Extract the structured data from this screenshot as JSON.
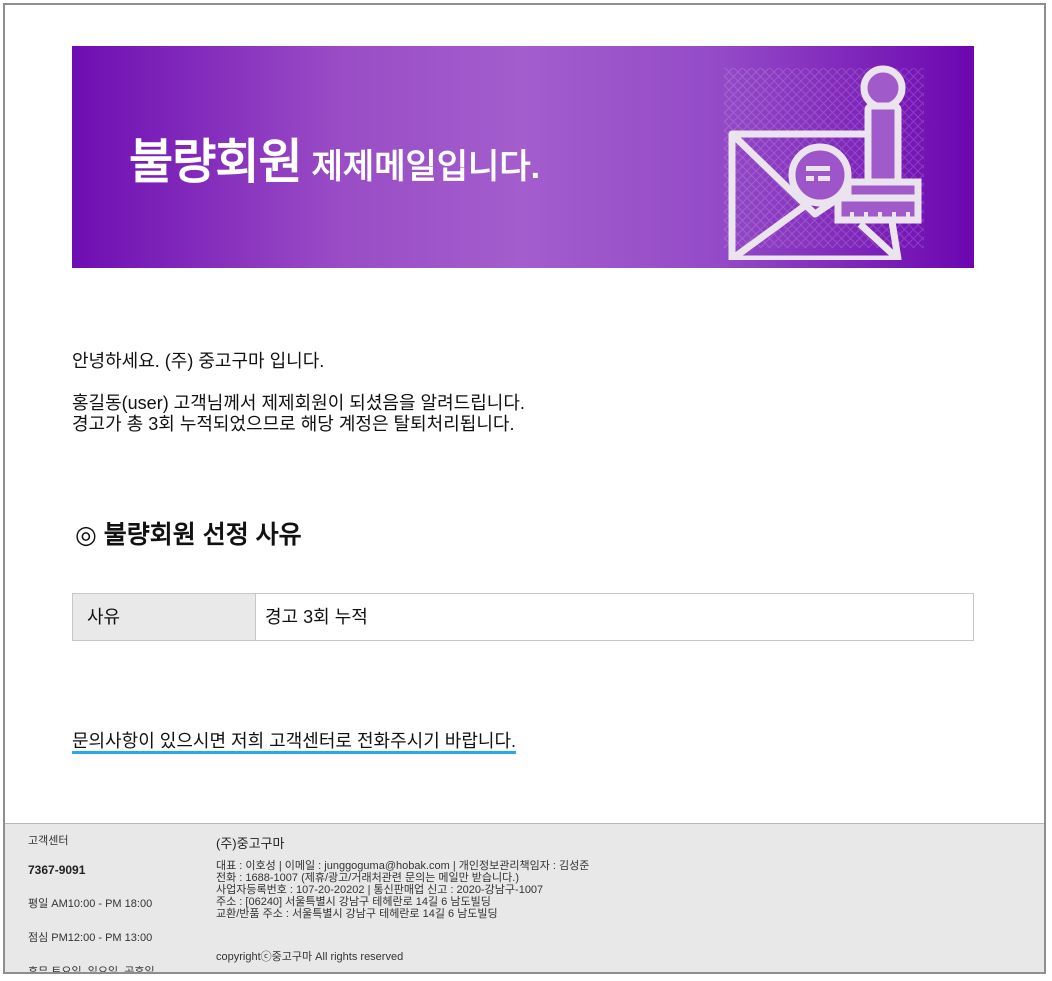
{
  "banner": {
    "title_strong": "불량회원",
    "title_rest": "제제메일입니다."
  },
  "body": {
    "greeting": "안녕하세요. (주) 중고구마 입니다.",
    "message_line1": "홍길동(user) 고객님께서 제제회원이 되셨음을 알려드립니다.",
    "message_line2": "경고가 총 3회 누적되었으므로 해당 계정은 탈퇴처리됩니다.",
    "section_title": "◎ 불량회원 선정 사유",
    "reason_label": "사유",
    "reason_value": "경고 3회 누적",
    "contact_text": "문의사항이 있으시면 저희 고객센터로 전화주시기 바랍니다."
  },
  "footer": {
    "cs_label": "고객센터",
    "cs_phone": "7367-9091",
    "weekday_hours": "평일 AM10:00 - PM 18:00",
    "lunch_hours": "점심 PM12:00 - PM 13:00",
    "holidays": "휴무 토요일, 일요일, 공휴일",
    "company_name": "(주)중고구마",
    "info_line1": "대표 : 이호성  |  이메일 :  junggoguma@hobak.com  |  개인정보관리책임자 : 김성준",
    "info_line2": "전화 : 1688-1007 (제휴/광고/거래처관련 문의는 메일만 받습니다.)",
    "info_line3": "사업자등록번호 : 107-20-20202  |  통신판매업 신고 : 2020-강남구-1007",
    "info_line4": "주소 : [06240] 서울특별시 강남구 테헤란로 14길 6 남도빌딩",
    "info_line5": "교환/반품 주소 : 서울특별시 강남구 테헤란로 14길 6 남도빌딩",
    "copyright": "copyrightⓒ중고구마 All rights reserved"
  },
  "colors": {
    "banner_dark": "#6e0db2",
    "banner_light": "#a35dcc",
    "link_underline": "#29a9e8",
    "footer_bg": "#e8e8e8"
  },
  "icons": {
    "banner_illustration": "envelope-stamp-icon"
  }
}
